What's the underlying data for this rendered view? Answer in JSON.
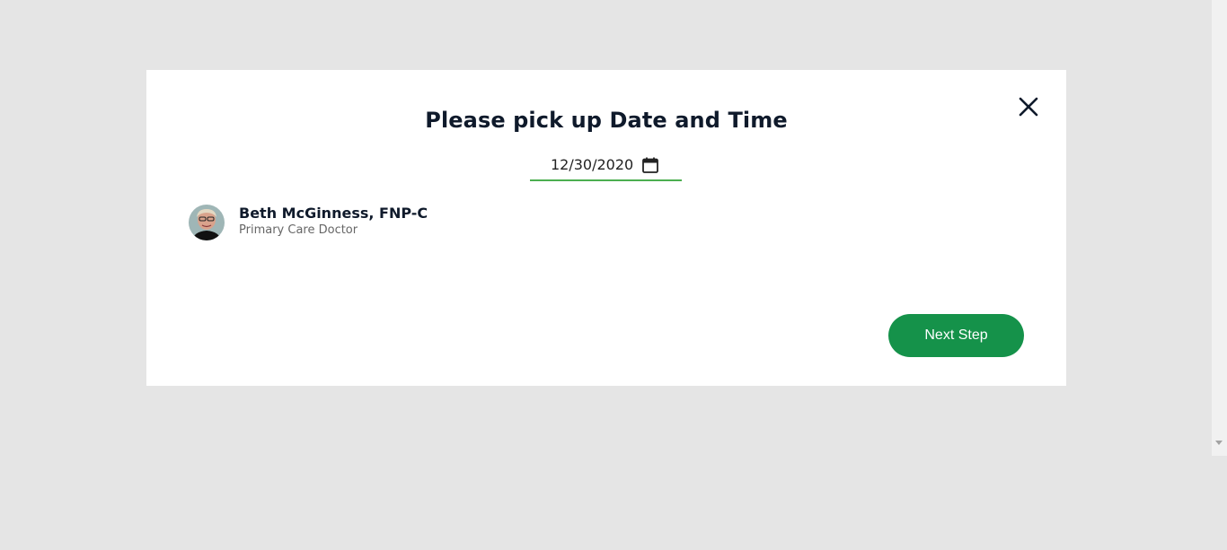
{
  "modal": {
    "title": "Please pick up Date and Time",
    "date": {
      "value": "12/30/2020",
      "icon": "calendar-icon"
    },
    "close_icon": "close-icon",
    "doctor": {
      "name": "Beth McGinness, FNP-C",
      "role": "Primary Care Doctor"
    },
    "next_button_label": "Next Step"
  },
  "colors": {
    "backdrop": "#e5e5e5",
    "accent_underline": "#4caf50",
    "primary_button": "#15924a",
    "title_text": "#0f1a2b"
  }
}
